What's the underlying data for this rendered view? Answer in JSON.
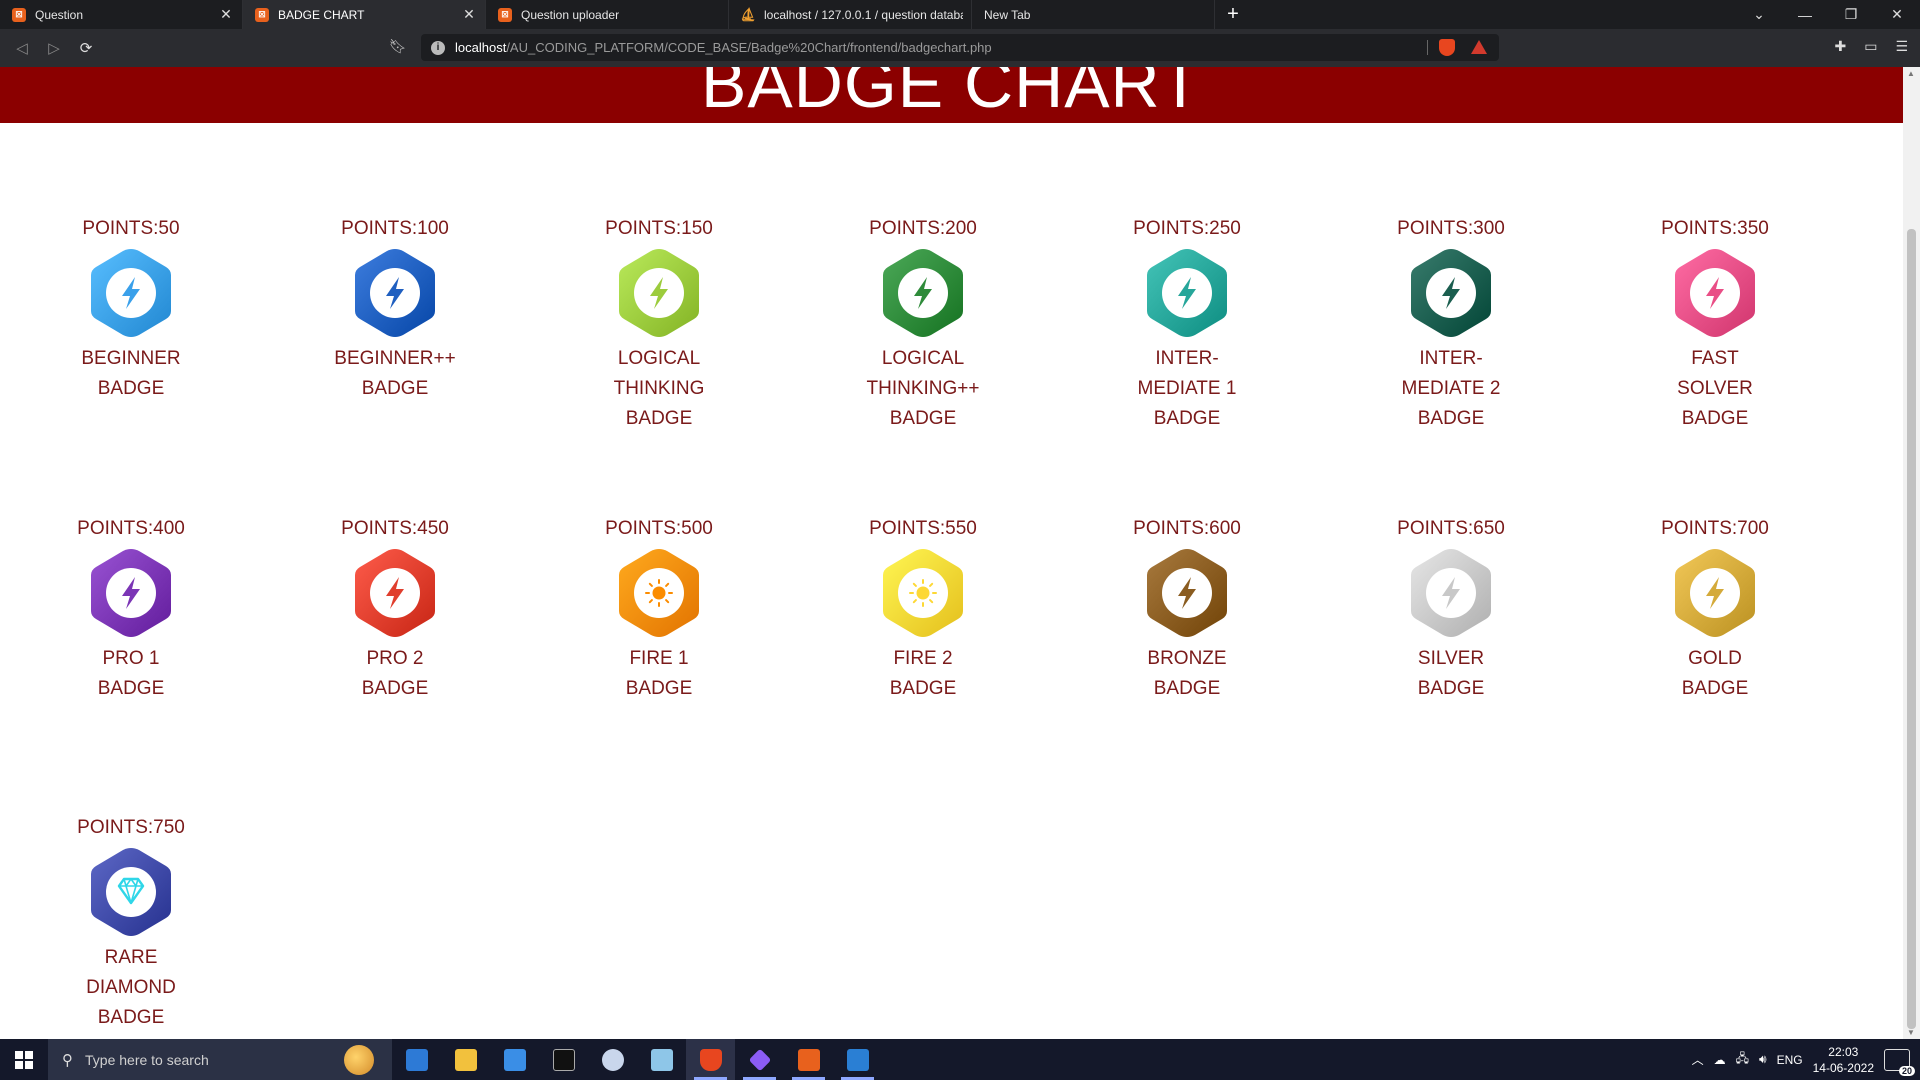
{
  "browser": {
    "tabs": [
      {
        "title": "Question",
        "favicon": "xampp-icon",
        "active": false
      },
      {
        "title": "BADGE CHART",
        "favicon": "xampp-icon",
        "active": true
      },
      {
        "title": "Question uploader",
        "favicon": "xampp-icon",
        "active": false
      },
      {
        "title": "localhost / 127.0.0.1 / question databa",
        "favicon": "phpmyadmin-icon",
        "active": false
      },
      {
        "title": "New Tab",
        "favicon": "",
        "active": false
      }
    ],
    "url_host": "localhost",
    "url_path": "/AU_CODING_PLATFORM/CODE_BASE/Badge%20Chart/frontend/badgechart.php",
    "brave_badge_count": "1"
  },
  "page": {
    "heading": "BADGE CHART",
    "banner_color": "#8b0000",
    "text_color": "#7a1a1a",
    "badges": [
      {
        "points": "POINTS:50",
        "name": [
          "BEGINNER",
          "BADGE"
        ],
        "color": "#3aa0ea",
        "inner": "bolt"
      },
      {
        "points": "POINTS:100",
        "name": [
          "BEGINNER++",
          "BADGE"
        ],
        "color": "#1f5fc0",
        "inner": "bolt"
      },
      {
        "points": "POINTS:150",
        "name": [
          "LOGICAL",
          "THINKING",
          "BADGE"
        ],
        "color": "#9ccc3d",
        "inner": "bolt"
      },
      {
        "points": "POINTS:200",
        "name": [
          "LOGICAL",
          "THINKING++",
          "BADGE"
        ],
        "color": "#2e8b3a",
        "inner": "bolt"
      },
      {
        "points": "POINTS:250",
        "name": [
          "INTER-",
          "MEDIATE 1",
          "BADGE"
        ],
        "color": "#26a69a",
        "inner": "bolt"
      },
      {
        "points": "POINTS:300",
        "name": [
          "INTER-",
          "MEDIATE 2",
          "BADGE"
        ],
        "color": "#1b5e4f",
        "inner": "bolt"
      },
      {
        "points": "POINTS:350",
        "name": [
          "FAST",
          "SOLVER",
          "BADGE"
        ],
        "color": "#e94e86",
        "inner": "bolt"
      },
      {
        "points": "POINTS:400",
        "name": [
          "PRO 1",
          "BADGE"
        ],
        "color": "#7b35b5",
        "inner": "bolt"
      },
      {
        "points": "POINTS:450",
        "name": [
          "PRO 2",
          "BADGE"
        ],
        "color": "#e03e2d",
        "inner": "bolt"
      },
      {
        "points": "POINTS:500",
        "name": [
          "FIRE 1",
          "BADGE"
        ],
        "color": "#fb8c00",
        "inner": "sun"
      },
      {
        "points": "POINTS:550",
        "name": [
          "FIRE 2",
          "BADGE"
        ],
        "color": "#fdd835",
        "inner": "sun"
      },
      {
        "points": "POINTS:600",
        "name": [
          "BRONZE",
          "BADGE"
        ],
        "color": "#8a5c20",
        "inner": "bolt"
      },
      {
        "points": "POINTS:650",
        "name": [
          "SILVER",
          "BADGE"
        ],
        "color": "#c8c8c8",
        "inner": "bolt"
      },
      {
        "points": "POINTS:700",
        "name": [
          "GOLD",
          "BADGE"
        ],
        "color": "#d4aa3a",
        "inner": "bolt"
      },
      {
        "points": "POINTS:750",
        "name": [
          "RARE",
          "DIAMOND",
          "BADGE"
        ],
        "color": "#3f4aa8",
        "inner": "diamond"
      }
    ]
  },
  "taskbar": {
    "search_placeholder": "Type here to search",
    "language": "ENG",
    "time": "22:03",
    "date": "14-06-2022",
    "notification_count": "20"
  }
}
